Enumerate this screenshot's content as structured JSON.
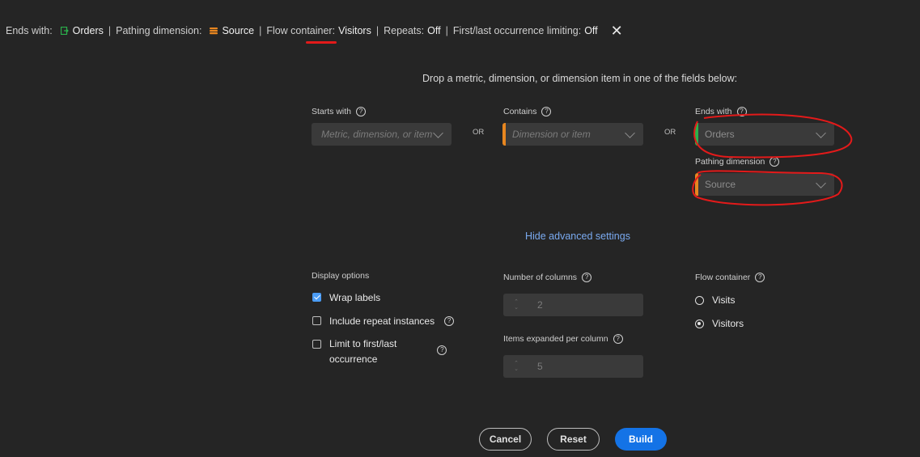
{
  "summary": {
    "ends_with_label": "Ends with:",
    "ends_with_value": "Orders",
    "pathing_label": "Pathing dimension:",
    "pathing_value": "Source",
    "flow_label": "Flow container:",
    "flow_value": "Visitors",
    "repeats_label": "Repeats:",
    "repeats_value": "Off",
    "first_last_label": "First/last occurrence limiting:",
    "first_last_value": "Off",
    "separator": "|",
    "close_glyph": "✕"
  },
  "instruction": "Drop a metric, dimension, or dimension item in one of the fields below:",
  "fields": {
    "starts_with": {
      "label": "Starts with",
      "placeholder": "Metric, dimension, or item"
    },
    "contains": {
      "label": "Contains",
      "placeholder": "Dimension or item"
    },
    "ends_with": {
      "label": "Ends with",
      "value": "Orders"
    },
    "pathing_dimension": {
      "label": "Pathing dimension",
      "value": "Source"
    },
    "or_label": "OR"
  },
  "advanced_link": "Hide advanced settings",
  "display_options": {
    "label": "Display options",
    "wrap_labels": {
      "label": "Wrap labels",
      "checked": true
    },
    "include_repeat": {
      "label": "Include repeat instances",
      "checked": false
    },
    "limit_first_last": {
      "label_line1": "Limit to first/last",
      "label_line2": "occurrence",
      "checked": false
    }
  },
  "columns": {
    "number_label": "Number of columns",
    "number_value": "2",
    "items_label": "Items expanded per column",
    "items_value": "5"
  },
  "flow_container": {
    "label": "Flow container",
    "options": [
      "Visits",
      "Visitors"
    ],
    "selected": "Visitors"
  },
  "buttons": {
    "cancel": "Cancel",
    "reset": "Reset",
    "build": "Build"
  },
  "help_glyph": "?",
  "colors": {
    "background": "#252525",
    "orange_bar": "#e8861f",
    "green_bar": "#2bb24c",
    "accent": "#1473e6",
    "annotation": "#e31a1a"
  }
}
